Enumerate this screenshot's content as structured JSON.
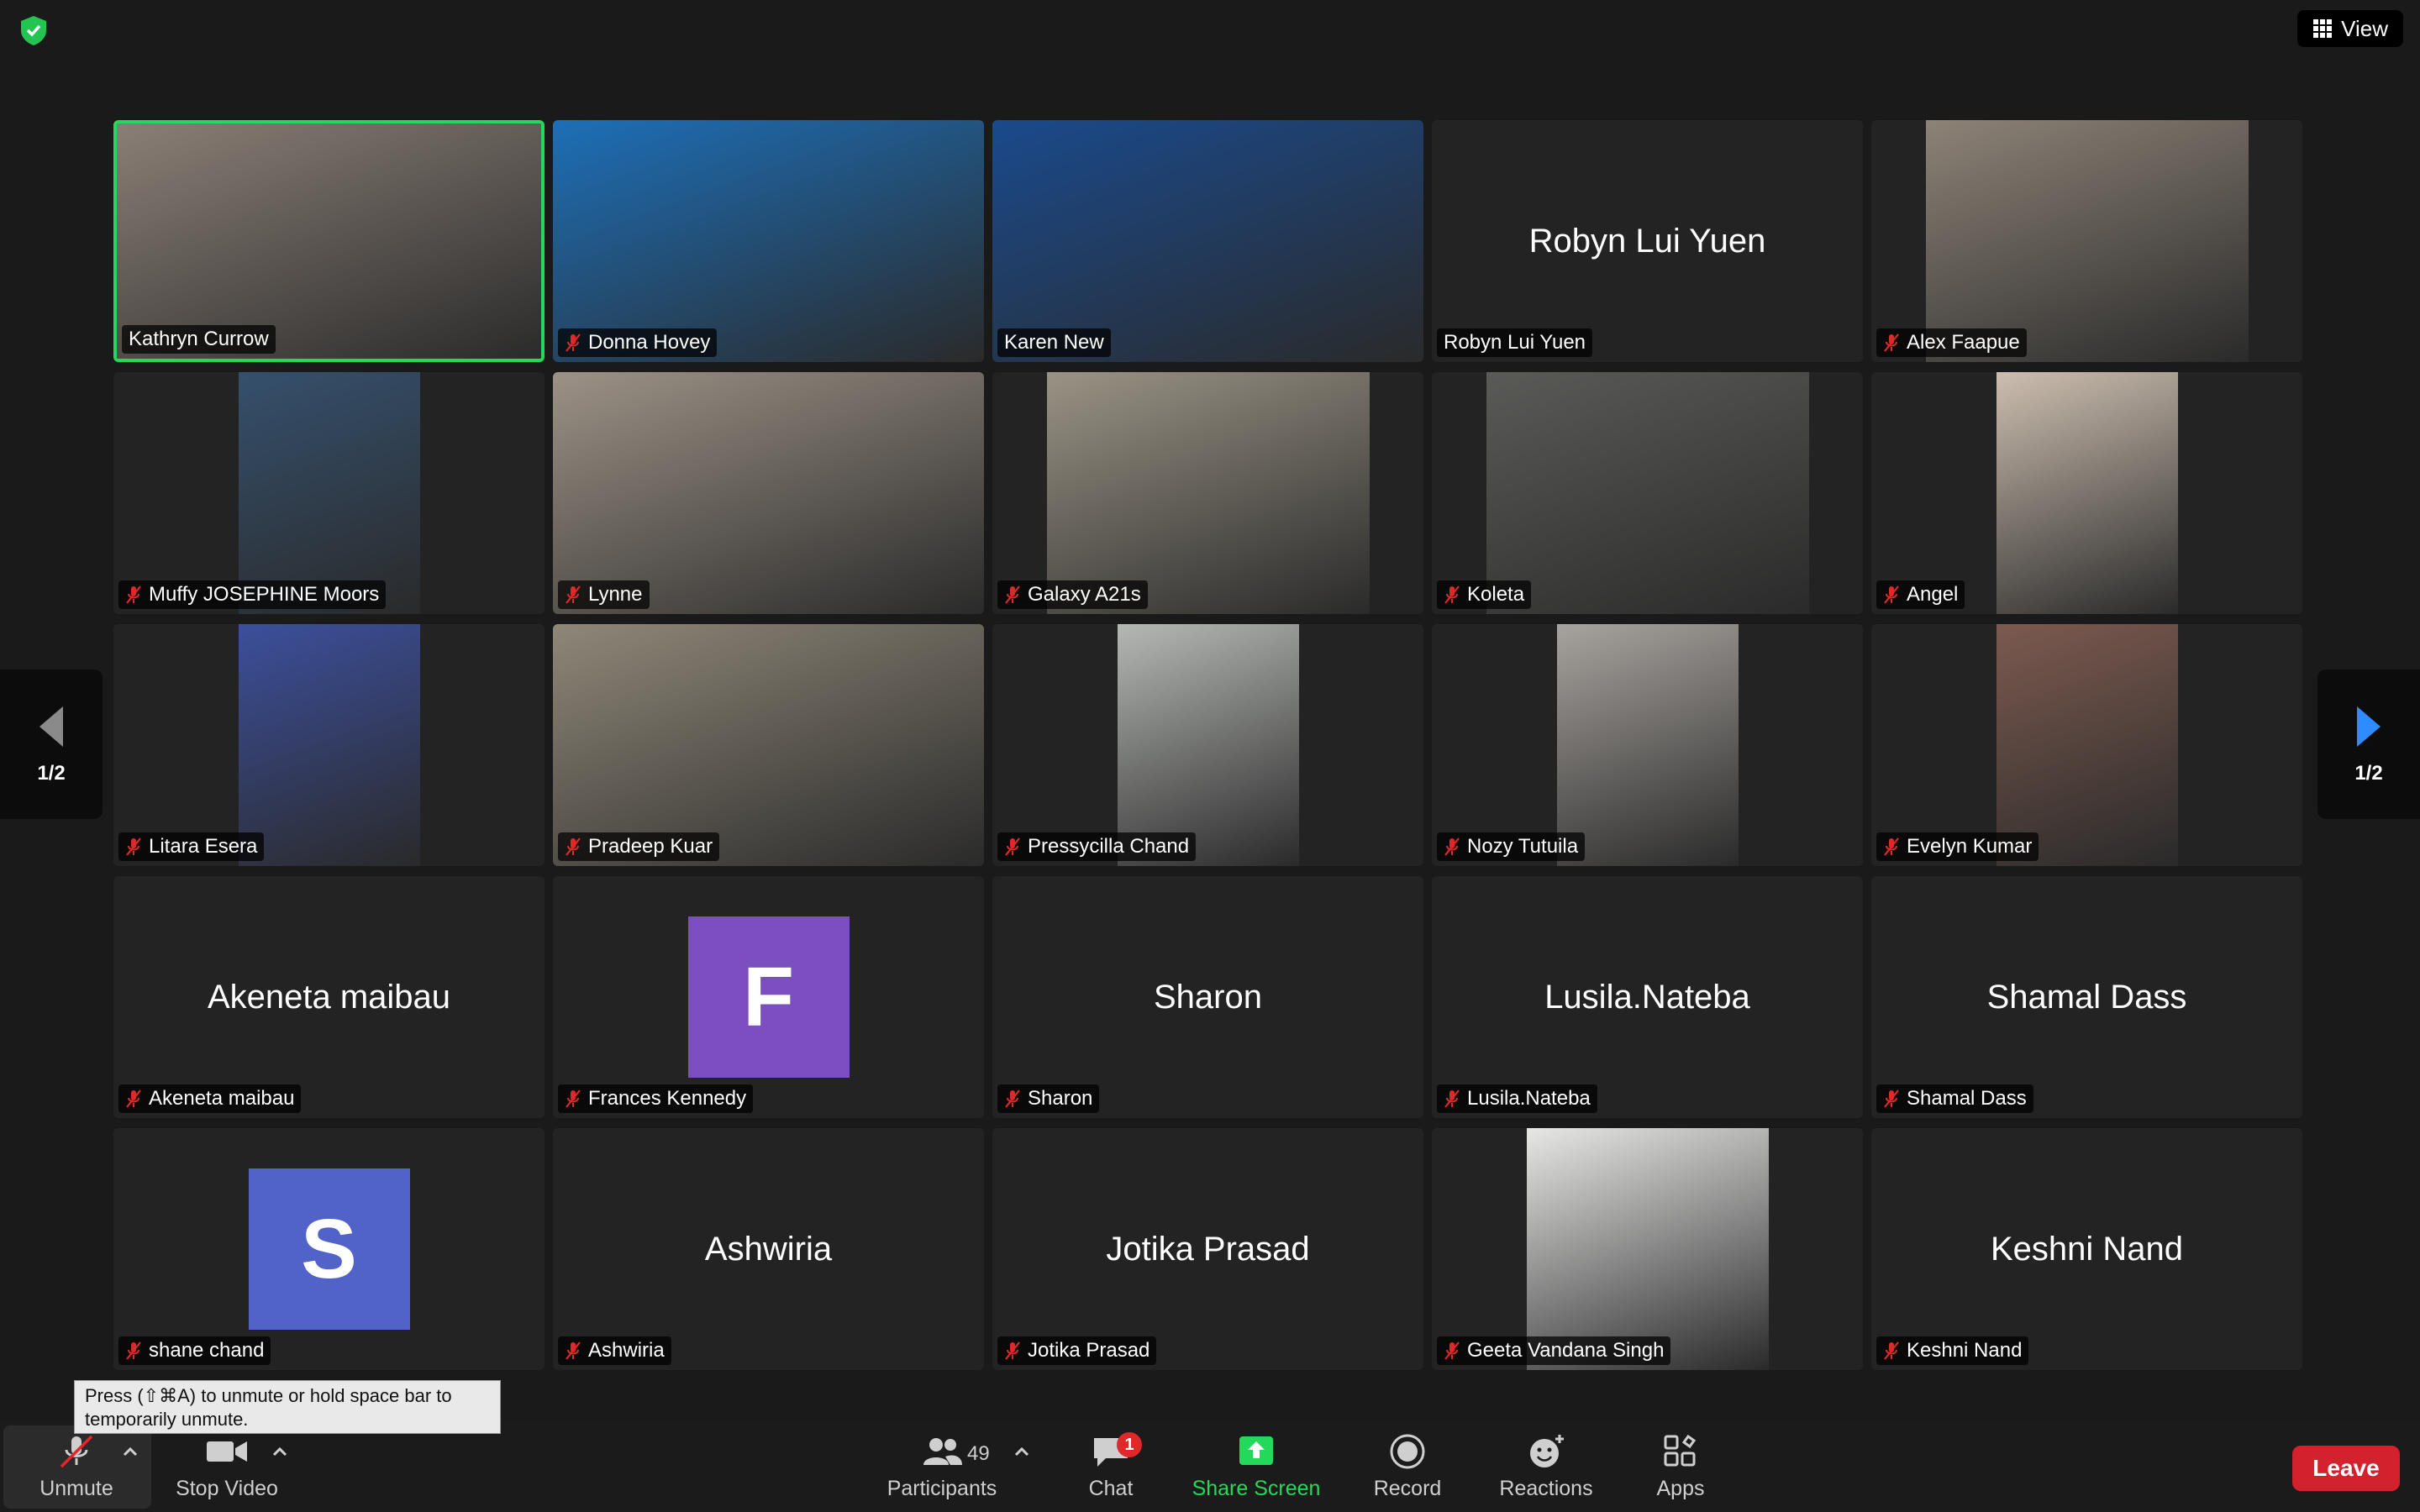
{
  "view": {
    "label": "View"
  },
  "pager": {
    "left_label": "1/2",
    "right_label": "1/2"
  },
  "tiles": [
    {
      "name": "Kathryn Currow",
      "muted": false,
      "mode": "video",
      "bg": "#8a7f76"
    },
    {
      "name": "Donna Hovey",
      "muted": true,
      "mode": "video",
      "bg": "#1d6fb8"
    },
    {
      "name": "Karen New",
      "muted": false,
      "mode": "video",
      "bg": "#1a4a8c"
    },
    {
      "name": "Robyn Lui Yuen",
      "muted": false,
      "mode": "name",
      "display": "Robyn Lui Yuen"
    },
    {
      "name": "Alex Faapue",
      "muted": true,
      "mode": "video",
      "bg": "#8d8377"
    },
    {
      "name": "Muffy JOSEPHINE Moors",
      "muted": true,
      "mode": "video",
      "bg": "#35506d"
    },
    {
      "name": "Lynne",
      "muted": true,
      "mode": "video",
      "bg": "#9c9286"
    },
    {
      "name": "Galaxy A21s",
      "muted": true,
      "mode": "video",
      "bg": "#9a9385"
    },
    {
      "name": "Koleta",
      "muted": true,
      "mode": "video",
      "bg": "#5a5a57"
    },
    {
      "name": "Angel",
      "muted": true,
      "mode": "video",
      "bg": "#cdbfb0"
    },
    {
      "name": "Litara Esera",
      "muted": true,
      "mode": "video",
      "bg": "#3c4f9c"
    },
    {
      "name": "Pradeep Kuar",
      "muted": true,
      "mode": "video",
      "bg": "#8f8778"
    },
    {
      "name": "Pressycilla Chand",
      "muted": true,
      "mode": "video",
      "bg": "#b5b8b4"
    },
    {
      "name": "Nozy Tutuila",
      "muted": true,
      "mode": "video",
      "bg": "#a8a39e"
    },
    {
      "name": "Evelyn Kumar",
      "muted": true,
      "mode": "video",
      "bg": "#7c5a4f"
    },
    {
      "name": "Akeneta maibau",
      "muted": true,
      "mode": "name",
      "display": "Akeneta maibau"
    },
    {
      "name": "Frances Kennedy",
      "muted": true,
      "mode": "avatar",
      "letter": "F",
      "color": "#7b4fc0"
    },
    {
      "name": "Sharon",
      "muted": true,
      "mode": "name",
      "display": "Sharon"
    },
    {
      "name": "Lusila.Nateba",
      "muted": true,
      "mode": "name",
      "display": "Lusila.Nateba"
    },
    {
      "name": "Shamal Dass",
      "muted": true,
      "mode": "name",
      "display": "Shamal Dass"
    },
    {
      "name": "shane chand",
      "muted": true,
      "mode": "avatar",
      "letter": "S",
      "color": "#5162c9"
    },
    {
      "name": "Ashwiria",
      "muted": true,
      "mode": "name",
      "display": "Ashwiria"
    },
    {
      "name": "Jotika Prasad",
      "muted": true,
      "mode": "name",
      "display": "Jotika Prasad"
    },
    {
      "name": "Geeta Vandana Singh",
      "muted": true,
      "mode": "video",
      "bg": "#e7e8e6"
    },
    {
      "name": "Keshni Nand",
      "muted": true,
      "mode": "name",
      "display": "Keshni Nand"
    }
  ],
  "tooltip": {
    "text": "Press (⇧⌘A) to unmute or hold space bar to temporarily unmute."
  },
  "toolbar": {
    "unmute": "Unmute",
    "stop_video": "Stop Video",
    "participants": "Participants",
    "participants_count": "49",
    "chat": "Chat",
    "chat_badge": "1",
    "share_screen": "Share Screen",
    "record": "Record",
    "reactions": "Reactions",
    "apps": "Apps",
    "leave": "Leave"
  },
  "colors": {
    "active_speaker": "#23d959",
    "share_screen": "#23d959",
    "leave": "#d3212d"
  }
}
